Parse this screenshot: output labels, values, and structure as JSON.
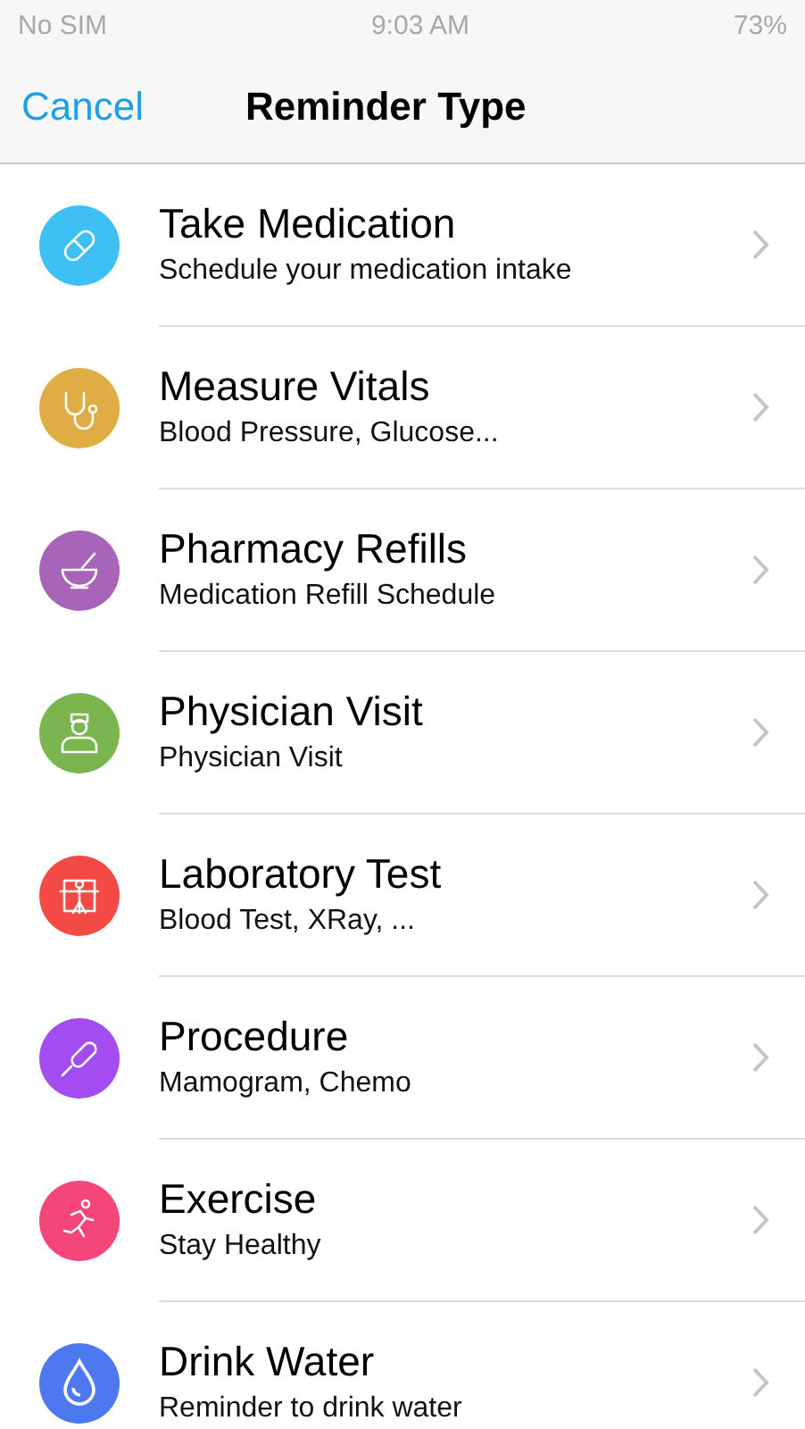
{
  "status_bar": {
    "carrier": "No SIM",
    "time": "9:03 AM",
    "battery": "73%"
  },
  "nav_bar": {
    "cancel": "Cancel",
    "title": "Reminder Type"
  },
  "items": [
    {
      "kind": "pill",
      "color": "#3fc0f5",
      "title": "Take Medication",
      "subtitle": "Schedule your medication intake"
    },
    {
      "kind": "stethoscope",
      "color": "#e0ad45",
      "title": "Measure Vitals",
      "subtitle": "Blood Pressure, Glucose..."
    },
    {
      "kind": "bowl",
      "color": "#a864b9",
      "title": "Pharmacy Refills",
      "subtitle": "Medication Refill Schedule"
    },
    {
      "kind": "doctor",
      "color": "#7bb550",
      "title": "Physician Visit",
      "subtitle": "Physician Visit"
    },
    {
      "kind": "xray",
      "color": "#f44a45",
      "title": "Laboratory Test",
      "subtitle": "Blood Test, XRay, ..."
    },
    {
      "kind": "syringe",
      "color": "#a34df0",
      "title": "Procedure",
      "subtitle": "Mamogram, Chemo"
    },
    {
      "kind": "runner",
      "color": "#f5467a",
      "title": "Exercise",
      "subtitle": "Stay Healthy"
    },
    {
      "kind": "drop",
      "color": "#4d78f0",
      "title": "Drink Water",
      "subtitle": "Reminder to drink water"
    }
  ]
}
